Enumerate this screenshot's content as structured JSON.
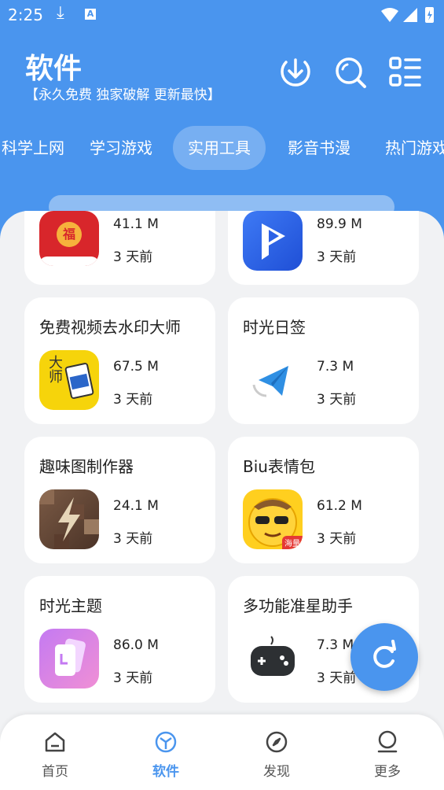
{
  "status_bar": {
    "time": "2:25",
    "letter": "A"
  },
  "header": {
    "title": "软件",
    "subtitle": "【永久免费 独家破解 更新最快】"
  },
  "tabs": [
    {
      "label": "科学上网"
    },
    {
      "label": "学习游戏"
    },
    {
      "label": "实用工具",
      "active": true
    },
    {
      "label": "影音书漫"
    },
    {
      "label": "热门游戏"
    }
  ],
  "apps": [
    {
      "name": "",
      "size": "41.1 M",
      "time": "3 天前",
      "icon": "red-envelope-icon",
      "glyph": "福"
    },
    {
      "name": "",
      "size": "89.9 M",
      "time": "3 天前",
      "icon": "video-player-icon"
    },
    {
      "name": "免费视频去水印大师",
      "size": "67.5 M",
      "time": "3 天前",
      "icon": "watermark-master-icon",
      "glyph": "大师"
    },
    {
      "name": "时光日签",
      "size": "7.3 M",
      "time": "3 天前",
      "icon": "paper-plane-icon"
    },
    {
      "name": "趣味图制作器",
      "size": "24.1 M",
      "time": "3 天前",
      "icon": "lightning-pixel-icon"
    },
    {
      "name": "Biu表情包",
      "size": "61.2 M",
      "time": "3 天前",
      "icon": "emoji-face-icon",
      "glyph": "海量"
    },
    {
      "name": "时光主题",
      "size": "86.0 M",
      "time": "3 天前",
      "icon": "theme-cards-icon"
    },
    {
      "name": "多功能准星助手",
      "size": "7.3 M",
      "time": "3 天前",
      "icon": "gamepad-icon"
    }
  ],
  "bottom_nav": [
    {
      "label": "首页",
      "icon": "home-icon"
    },
    {
      "label": "软件",
      "icon": "software-icon",
      "active": true
    },
    {
      "label": "发现",
      "icon": "compass-icon"
    },
    {
      "label": "更多",
      "icon": "user-icon"
    }
  ],
  "colors": {
    "primary": "#4a95ee",
    "background": "#f1f2f4",
    "card": "#ffffff"
  }
}
